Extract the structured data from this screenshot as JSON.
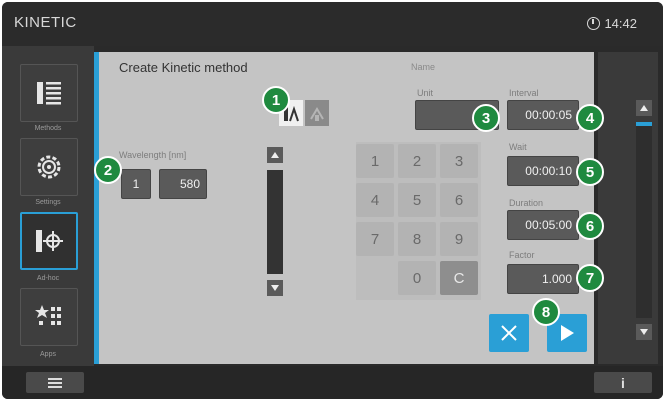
{
  "app": {
    "brand": "KINETIC",
    "time": "14:42"
  },
  "sidebar": {
    "items": [
      {
        "label": "Methods",
        "icon": "methods-list-icon"
      },
      {
        "label": "Settings",
        "icon": "gear-icon"
      },
      {
        "label": "Ad-hoc",
        "icon": "adhoc-icon",
        "active": true
      },
      {
        "label": "Apps",
        "icon": "apps-icon"
      }
    ]
  },
  "panel": {
    "title": "Create Kinetic method",
    "name_label": "Name",
    "wavelength_label": "Wavelength [nm]",
    "wavelength_index": "1",
    "wavelength_value": "580",
    "unit_label": "Unit",
    "interval_label": "Interval",
    "interval_value": "00:00:05",
    "wait_label": "Wait",
    "wait_value": "00:00:10",
    "duration_label": "Duration",
    "duration_value": "00:05:00",
    "factor_label": "Factor",
    "factor_value": "1.000"
  },
  "keypad": {
    "keys": [
      "1",
      "2",
      "3",
      "4",
      "5",
      "6",
      "7",
      "8",
      "9",
      "",
      "0",
      "C"
    ]
  },
  "badges": [
    "1",
    "2",
    "3",
    "4",
    "5",
    "6",
    "7",
    "8"
  ],
  "footer": {
    "info_label": "i"
  }
}
